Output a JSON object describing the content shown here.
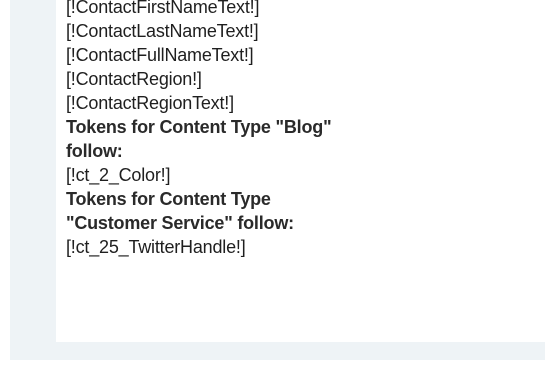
{
  "token_list": {
    "items": [
      {
        "kind": "token",
        "text": "[!ContactFirstNameText!]"
      },
      {
        "kind": "token",
        "text": "[!ContactLastNameText!]"
      },
      {
        "kind": "token",
        "text": "[!ContactFullNameText!]"
      },
      {
        "kind": "token",
        "text": "[!ContactRegion!]"
      },
      {
        "kind": "token",
        "text": "[!ContactRegionText!]"
      },
      {
        "kind": "heading",
        "text": "Tokens for Content Type \"Blog\""
      },
      {
        "kind": "heading",
        "text": "follow:"
      },
      {
        "kind": "token",
        "text": "[!ct_2_Color!]"
      },
      {
        "kind": "heading",
        "text": "Tokens for Content Type"
      },
      {
        "kind": "heading",
        "text": "\"Customer Service\" follow:"
      },
      {
        "kind": "token",
        "text": "[!ct_25_TwitterHandle!]"
      }
    ]
  }
}
